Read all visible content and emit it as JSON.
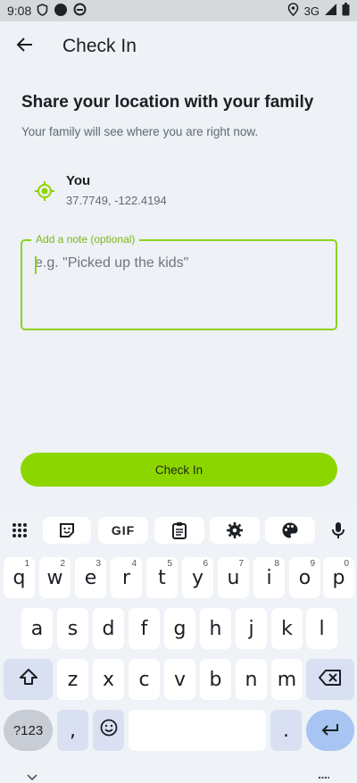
{
  "status_bar": {
    "time": "9:08",
    "network": "3G"
  },
  "app_bar": {
    "title": "Check In",
    "back_icon": "arrow-back-icon"
  },
  "content": {
    "headline": "Share your location with your family",
    "subtext": "Your family will see where you are right now.",
    "location": {
      "name": "You",
      "coords": "37.7749, -122.4194",
      "icon": "my-location-icon"
    },
    "note": {
      "label": "Add a note (optional)",
      "placeholder": "e.g. \"Picked up the kids\"",
      "value": ""
    },
    "checkin_button": "Check In"
  },
  "keyboard": {
    "toolbar": [
      "apps-grid-icon",
      "sticker-icon",
      "GIF",
      "clipboard-icon",
      "gear-icon",
      "palette-icon",
      "mic-icon"
    ],
    "row1": [
      {
        "k": "q",
        "h": "1"
      },
      {
        "k": "w",
        "h": "2"
      },
      {
        "k": "e",
        "h": "3"
      },
      {
        "k": "r",
        "h": "4"
      },
      {
        "k": "t",
        "h": "5"
      },
      {
        "k": "y",
        "h": "6"
      },
      {
        "k": "u",
        "h": "7"
      },
      {
        "k": "i",
        "h": "8"
      },
      {
        "k": "o",
        "h": "9"
      },
      {
        "k": "p",
        "h": "0"
      }
    ],
    "row2": [
      "a",
      "s",
      "d",
      "f",
      "g",
      "h",
      "j",
      "k",
      "l"
    ],
    "row3": [
      "z",
      "x",
      "c",
      "v",
      "b",
      "n",
      "m"
    ],
    "symbols_label": "?123",
    "comma": ",",
    "period": "."
  },
  "colors": {
    "accent": "#8cd600",
    "focus_border": "#8bd21e",
    "background": "#eef1f5"
  }
}
